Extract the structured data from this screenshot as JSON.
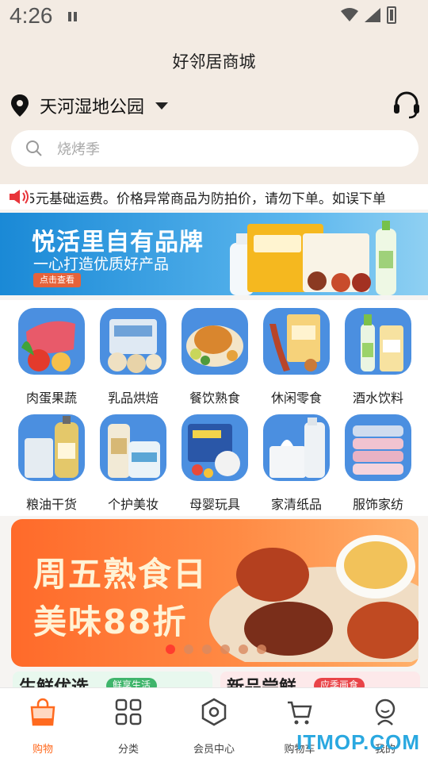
{
  "status_bar": {
    "time": "4:26"
  },
  "header": {
    "title": "好邻居商城"
  },
  "location": {
    "name": "天河湿地公园"
  },
  "search": {
    "placeholder": "烧烤季"
  },
  "notice": {
    "text": "5元基础运费。价格异常商品为防拍价，请勿下单。如误下单"
  },
  "brand_banner": {
    "title": "悦活里自有品牌",
    "subtitle": "一心打造优质好产品",
    "button": "点击查看"
  },
  "categories": [
    {
      "label": "肉蛋果蔬",
      "icon": "produce-icon",
      "color": "#3a7fd0"
    },
    {
      "label": "乳品烘焙",
      "icon": "dairy-icon",
      "color": "#3a7fd0"
    },
    {
      "label": "餐饮熟食",
      "icon": "deli-icon",
      "color": "#3a7fd0"
    },
    {
      "label": "休闲零食",
      "icon": "snacks-icon",
      "color": "#3a7fd0"
    },
    {
      "label": "酒水饮料",
      "icon": "drinks-icon",
      "color": "#3a7fd0"
    },
    {
      "label": "粮油干货",
      "icon": "grain-oil-icon",
      "color": "#3a7fd0"
    },
    {
      "label": "个护美妆",
      "icon": "beauty-icon",
      "color": "#3a7fd0"
    },
    {
      "label": "母婴玩具",
      "icon": "baby-toys-icon",
      "color": "#3a7fd0"
    },
    {
      "label": "家清纸品",
      "icon": "household-icon",
      "color": "#3a7fd0"
    },
    {
      "label": "服饰家纺",
      "icon": "textile-icon",
      "color": "#3a7fd0"
    }
  ],
  "promo_banner": {
    "line1": "周五熟食日",
    "line2": "美味88折",
    "slide_index": 1,
    "slide_count": 6
  },
  "section_peeks": {
    "left": {
      "title": "生鲜优选",
      "tag": "鲜享生活"
    },
    "right": {
      "title": "新品尝鲜",
      "tag": "应季画食"
    }
  },
  "tabbar": [
    {
      "label": "购物",
      "active": true
    },
    {
      "label": "分类"
    },
    {
      "label": "会员中心"
    },
    {
      "label": "购物车"
    },
    {
      "label": "我的"
    }
  ],
  "watermark": "ITMOP.COM",
  "colors": {
    "accent": "#ff6a1f",
    "banner_blue": "#1a89d6",
    "promo_orange": "#ff6a2a"
  }
}
